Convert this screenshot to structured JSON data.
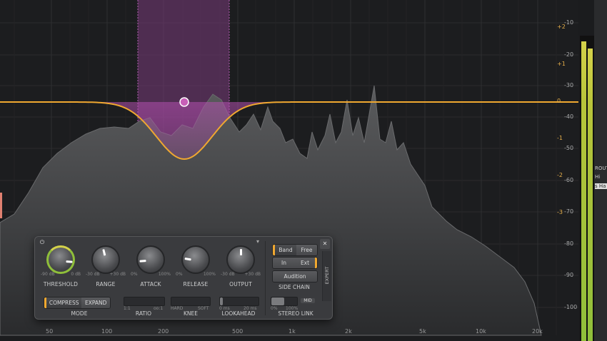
{
  "db_scale": [
    "-10",
    "-20",
    "-30",
    "-40",
    "-50",
    "-60",
    "-70",
    "-80",
    "-90",
    "-100"
  ],
  "gain_scale": [
    "+2",
    "+1",
    "0",
    "-1",
    "-2",
    "-3"
  ],
  "freq_labels": [
    "50",
    "100",
    "200",
    "500",
    "1k",
    "2k",
    "5k",
    "10k",
    "20k"
  ],
  "colors": {
    "accent": "#f0a830",
    "band": "#b44fb0",
    "node": "#c85fb8",
    "meter_green": "#8fbf3a",
    "meter_yellow": "#d4d24a"
  },
  "panel": {
    "knobs": [
      {
        "id": "threshold",
        "label": "THRESHOLD",
        "min": "-90 dB",
        "max": "0 dB",
        "level": 0.85
      },
      {
        "id": "range",
        "label": "RANGE",
        "min": "-30 dB",
        "max": "+30 dB",
        "level": 0.45
      },
      {
        "id": "attack",
        "label": "ATTACK",
        "min": "0%",
        "max": "100%",
        "level": 0.15
      },
      {
        "id": "release",
        "label": "RELEASE",
        "min": "0%",
        "max": "100%",
        "level": 0.2
      },
      {
        "id": "output",
        "label": "OUTPUT",
        "min": "-30 dB",
        "max": "+30 dB",
        "level": 0.5
      }
    ],
    "mode": {
      "label": "MODE",
      "options": [
        "COMPRESS",
        "EXPAND"
      ],
      "selected": "COMPRESS"
    },
    "ratio": {
      "label": "RATIO",
      "min": "1:1",
      "max": "oo:1",
      "level": 0.0
    },
    "knee": {
      "label": "KNEE",
      "min": "HARD",
      "max": "SOFT",
      "level": 0.0
    },
    "lookahead": {
      "label": "LOOKAHEAD",
      "min": "0 ms",
      "max": "20 ms",
      "level": 0.0
    },
    "band_free": {
      "options": [
        "Band",
        "Free"
      ],
      "selected": "Band"
    },
    "in_ext": {
      "options": [
        "In",
        "Ext"
      ],
      "selected": "Ext"
    },
    "audition": "Audition",
    "side_chain": "SIDE CHAIN",
    "stereo_link": {
      "label": "STEREO LINK",
      "min": "0%",
      "max": "100%",
      "mid": "MID",
      "level": 0.5
    },
    "expert": "EXPERT",
    "close": "✕",
    "power": "⏻",
    "menu": "▾"
  },
  "right_strip": {
    "fragments": [
      "ROUTI",
      "Hi",
      "s Ha"
    ]
  }
}
